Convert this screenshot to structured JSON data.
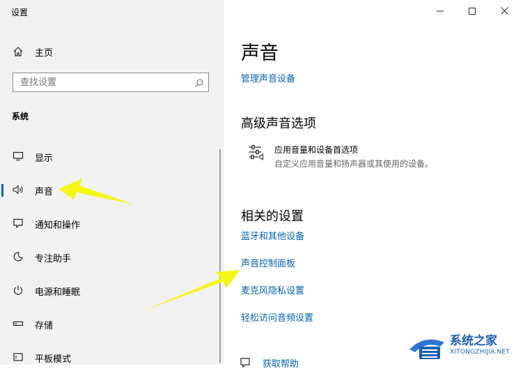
{
  "window": {
    "title": "设置"
  },
  "sidebar": {
    "home_label": "主页",
    "search_placeholder": "查找设置",
    "section_label": "系统",
    "items": [
      {
        "label": "显示",
        "icon": "monitor-icon"
      },
      {
        "label": "声音",
        "icon": "speaker-icon",
        "active": true
      },
      {
        "label": "通知和操作",
        "icon": "notification-icon"
      },
      {
        "label": "专注助手",
        "icon": "moon-icon"
      },
      {
        "label": "电源和睡眠",
        "icon": "power-icon"
      },
      {
        "label": "存储",
        "icon": "storage-icon"
      },
      {
        "label": "平板模式",
        "icon": "tablet-icon"
      }
    ]
  },
  "main": {
    "title": "声音",
    "manage_link": "管理声音设备",
    "advanced_heading": "高级声音选项",
    "app_volume_title": "应用音量和设备首选项",
    "app_volume_desc": "自定义应用音量和扬声器或其使用的设备。",
    "related_heading": "相关的设置",
    "related_links": [
      "蓝牙和其他设备",
      "声音控制面板",
      "麦克风隐私设置",
      "轻松访问音频设置"
    ],
    "help_link": "获取帮助"
  },
  "watermark": {
    "name": "系统之家",
    "url": "XITONGZHIJIA.NET"
  },
  "colors": {
    "accent": "#0063b1",
    "sidebar_bg": "#f2f2f2",
    "arrow": "#f5f516"
  }
}
